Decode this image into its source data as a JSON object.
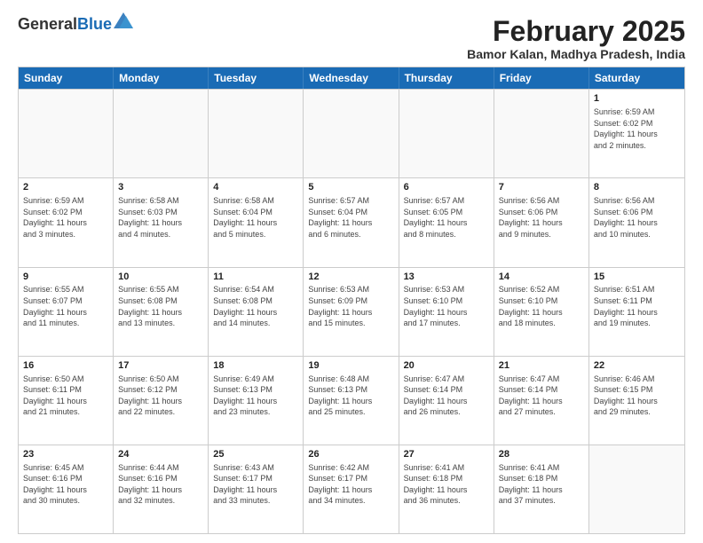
{
  "logo": {
    "line1": "General",
    "line2": "Blue"
  },
  "title": "February 2025",
  "location": "Bamor Kalan, Madhya Pradesh, India",
  "days_of_week": [
    "Sunday",
    "Monday",
    "Tuesday",
    "Wednesday",
    "Thursday",
    "Friday",
    "Saturday"
  ],
  "weeks": [
    [
      {
        "day": "",
        "info": ""
      },
      {
        "day": "",
        "info": ""
      },
      {
        "day": "",
        "info": ""
      },
      {
        "day": "",
        "info": ""
      },
      {
        "day": "",
        "info": ""
      },
      {
        "day": "",
        "info": ""
      },
      {
        "day": "1",
        "info": "Sunrise: 6:59 AM\nSunset: 6:02 PM\nDaylight: 11 hours\nand 2 minutes."
      }
    ],
    [
      {
        "day": "2",
        "info": "Sunrise: 6:59 AM\nSunset: 6:02 PM\nDaylight: 11 hours\nand 3 minutes."
      },
      {
        "day": "3",
        "info": "Sunrise: 6:58 AM\nSunset: 6:03 PM\nDaylight: 11 hours\nand 4 minutes."
      },
      {
        "day": "4",
        "info": "Sunrise: 6:58 AM\nSunset: 6:04 PM\nDaylight: 11 hours\nand 5 minutes."
      },
      {
        "day": "5",
        "info": "Sunrise: 6:57 AM\nSunset: 6:04 PM\nDaylight: 11 hours\nand 6 minutes."
      },
      {
        "day": "6",
        "info": "Sunrise: 6:57 AM\nSunset: 6:05 PM\nDaylight: 11 hours\nand 8 minutes."
      },
      {
        "day": "7",
        "info": "Sunrise: 6:56 AM\nSunset: 6:06 PM\nDaylight: 11 hours\nand 9 minutes."
      },
      {
        "day": "8",
        "info": "Sunrise: 6:56 AM\nSunset: 6:06 PM\nDaylight: 11 hours\nand 10 minutes."
      }
    ],
    [
      {
        "day": "9",
        "info": "Sunrise: 6:55 AM\nSunset: 6:07 PM\nDaylight: 11 hours\nand 11 minutes."
      },
      {
        "day": "10",
        "info": "Sunrise: 6:55 AM\nSunset: 6:08 PM\nDaylight: 11 hours\nand 13 minutes."
      },
      {
        "day": "11",
        "info": "Sunrise: 6:54 AM\nSunset: 6:08 PM\nDaylight: 11 hours\nand 14 minutes."
      },
      {
        "day": "12",
        "info": "Sunrise: 6:53 AM\nSunset: 6:09 PM\nDaylight: 11 hours\nand 15 minutes."
      },
      {
        "day": "13",
        "info": "Sunrise: 6:53 AM\nSunset: 6:10 PM\nDaylight: 11 hours\nand 17 minutes."
      },
      {
        "day": "14",
        "info": "Sunrise: 6:52 AM\nSunset: 6:10 PM\nDaylight: 11 hours\nand 18 minutes."
      },
      {
        "day": "15",
        "info": "Sunrise: 6:51 AM\nSunset: 6:11 PM\nDaylight: 11 hours\nand 19 minutes."
      }
    ],
    [
      {
        "day": "16",
        "info": "Sunrise: 6:50 AM\nSunset: 6:11 PM\nDaylight: 11 hours\nand 21 minutes."
      },
      {
        "day": "17",
        "info": "Sunrise: 6:50 AM\nSunset: 6:12 PM\nDaylight: 11 hours\nand 22 minutes."
      },
      {
        "day": "18",
        "info": "Sunrise: 6:49 AM\nSunset: 6:13 PM\nDaylight: 11 hours\nand 23 minutes."
      },
      {
        "day": "19",
        "info": "Sunrise: 6:48 AM\nSunset: 6:13 PM\nDaylight: 11 hours\nand 25 minutes."
      },
      {
        "day": "20",
        "info": "Sunrise: 6:47 AM\nSunset: 6:14 PM\nDaylight: 11 hours\nand 26 minutes."
      },
      {
        "day": "21",
        "info": "Sunrise: 6:47 AM\nSunset: 6:14 PM\nDaylight: 11 hours\nand 27 minutes."
      },
      {
        "day": "22",
        "info": "Sunrise: 6:46 AM\nSunset: 6:15 PM\nDaylight: 11 hours\nand 29 minutes."
      }
    ],
    [
      {
        "day": "23",
        "info": "Sunrise: 6:45 AM\nSunset: 6:16 PM\nDaylight: 11 hours\nand 30 minutes."
      },
      {
        "day": "24",
        "info": "Sunrise: 6:44 AM\nSunset: 6:16 PM\nDaylight: 11 hours\nand 32 minutes."
      },
      {
        "day": "25",
        "info": "Sunrise: 6:43 AM\nSunset: 6:17 PM\nDaylight: 11 hours\nand 33 minutes."
      },
      {
        "day": "26",
        "info": "Sunrise: 6:42 AM\nSunset: 6:17 PM\nDaylight: 11 hours\nand 34 minutes."
      },
      {
        "day": "27",
        "info": "Sunrise: 6:41 AM\nSunset: 6:18 PM\nDaylight: 11 hours\nand 36 minutes."
      },
      {
        "day": "28",
        "info": "Sunrise: 6:41 AM\nSunset: 6:18 PM\nDaylight: 11 hours\nand 37 minutes."
      },
      {
        "day": "",
        "info": ""
      }
    ]
  ]
}
